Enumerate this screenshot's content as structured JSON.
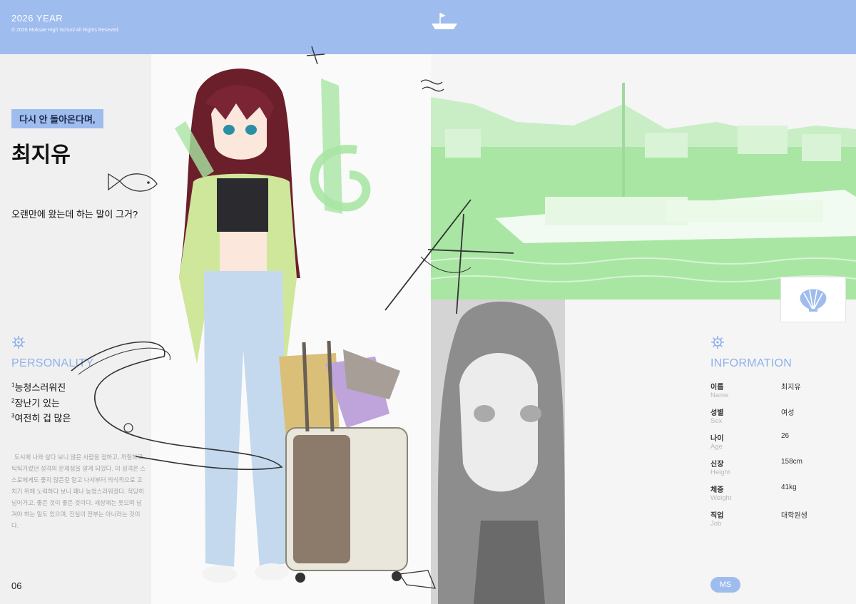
{
  "header": {
    "year": "2026 YEAR",
    "copyright": "© 2026 Moksae High School All Rights Reseved."
  },
  "profile": {
    "quote": "다시 안 돌아온다며,",
    "name": "최지유",
    "tagline": "오랜만에 왔는데 하는 말이 그거?"
  },
  "personality": {
    "title": "PERSONALITY",
    "traits": [
      {
        "num": "1",
        "text": "능청스러워진"
      },
      {
        "num": "2",
        "text": "장난기 있는"
      },
      {
        "num": "3",
        "text": "여전히 겁 많은"
      }
    ],
    "bio": "도시에 나와 살다 보니 많은 사람을 접하고, 까칠하고 틱틱거렸던 성격의 문제점을 알게 되었다. 이 성격은 스스로에게도 좋지 않은걸 알고 나서부터 의식적으로 고치기 위해 노력하다 보니 꽤나 능청스러워졌다. 적당히 넘어가고, 좋은 것이 좋은 것이다. 세상에는 웃으며 넘겨야 하는 일도 있으며, 진실이 전부는 아니라는 것이다."
  },
  "information": {
    "title": "INFORMATION",
    "rows": [
      {
        "label": "이름",
        "sub": "Name",
        "value": "최지유"
      },
      {
        "label": "성별",
        "sub": "Sex",
        "value": "여성"
      },
      {
        "label": "나이",
        "sub": "Age",
        "value": "26"
      },
      {
        "label": "신장",
        "sub": "Height",
        "value": "158cm"
      },
      {
        "label": "체중",
        "sub": "Weight",
        "value": "41kg"
      },
      {
        "label": "직업",
        "sub": "Job",
        "value": "대학원생"
      }
    ]
  },
  "footer": {
    "page_number": "06",
    "badge": "MS"
  },
  "colors": {
    "accent_blue": "#9fbcee",
    "accent_green": "#a9e6a4",
    "title_blue": "#8eb1eb"
  },
  "icons": [
    "boat-icon",
    "fish-icon",
    "helm-icon",
    "shell-icon"
  ]
}
